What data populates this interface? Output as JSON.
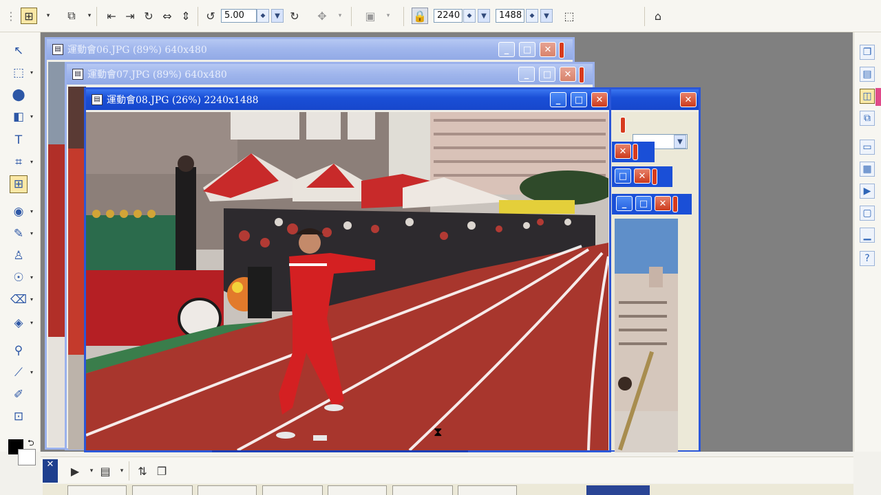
{
  "toolbar": {
    "rotate_value": "5.00",
    "width_value": "2240",
    "height_value": "1488"
  },
  "windows": [
    {
      "title": "運動會06.JPG (89%) 640x480"
    },
    {
      "title": "運動會07.JPG (89%) 640x480"
    },
    {
      "title": "運動會08.JPG (26%) 2240x1488"
    }
  ],
  "left_tools": [
    "pick-tool",
    "crop-select-tool",
    "shape-tool",
    "object-tool",
    "text-tool",
    "crop-tool",
    "transform-tool",
    "red-eye-tool",
    "brush-tool",
    "clone-tool",
    "dodge-tool",
    "eraser-tool",
    "fill-tool",
    "zoom-tool",
    "eyedropper-tool",
    "pen-tool",
    "resize-tool"
  ],
  "right_tools": [
    "copy-icon",
    "panel-icon",
    "layers-icon",
    "pages-icon",
    "window-icon",
    "color-icon",
    "play-icon",
    "info-icon",
    "histogram-icon",
    "help-icon"
  ],
  "colors": {
    "titlebar_active": "#1a4fd7",
    "titlebar_inactive": "#9fb5ec",
    "close_button": "#cc3a1c",
    "workspace": "#808080",
    "toolbar_bg": "#f7f6f1",
    "track_red": "#a8362d"
  }
}
